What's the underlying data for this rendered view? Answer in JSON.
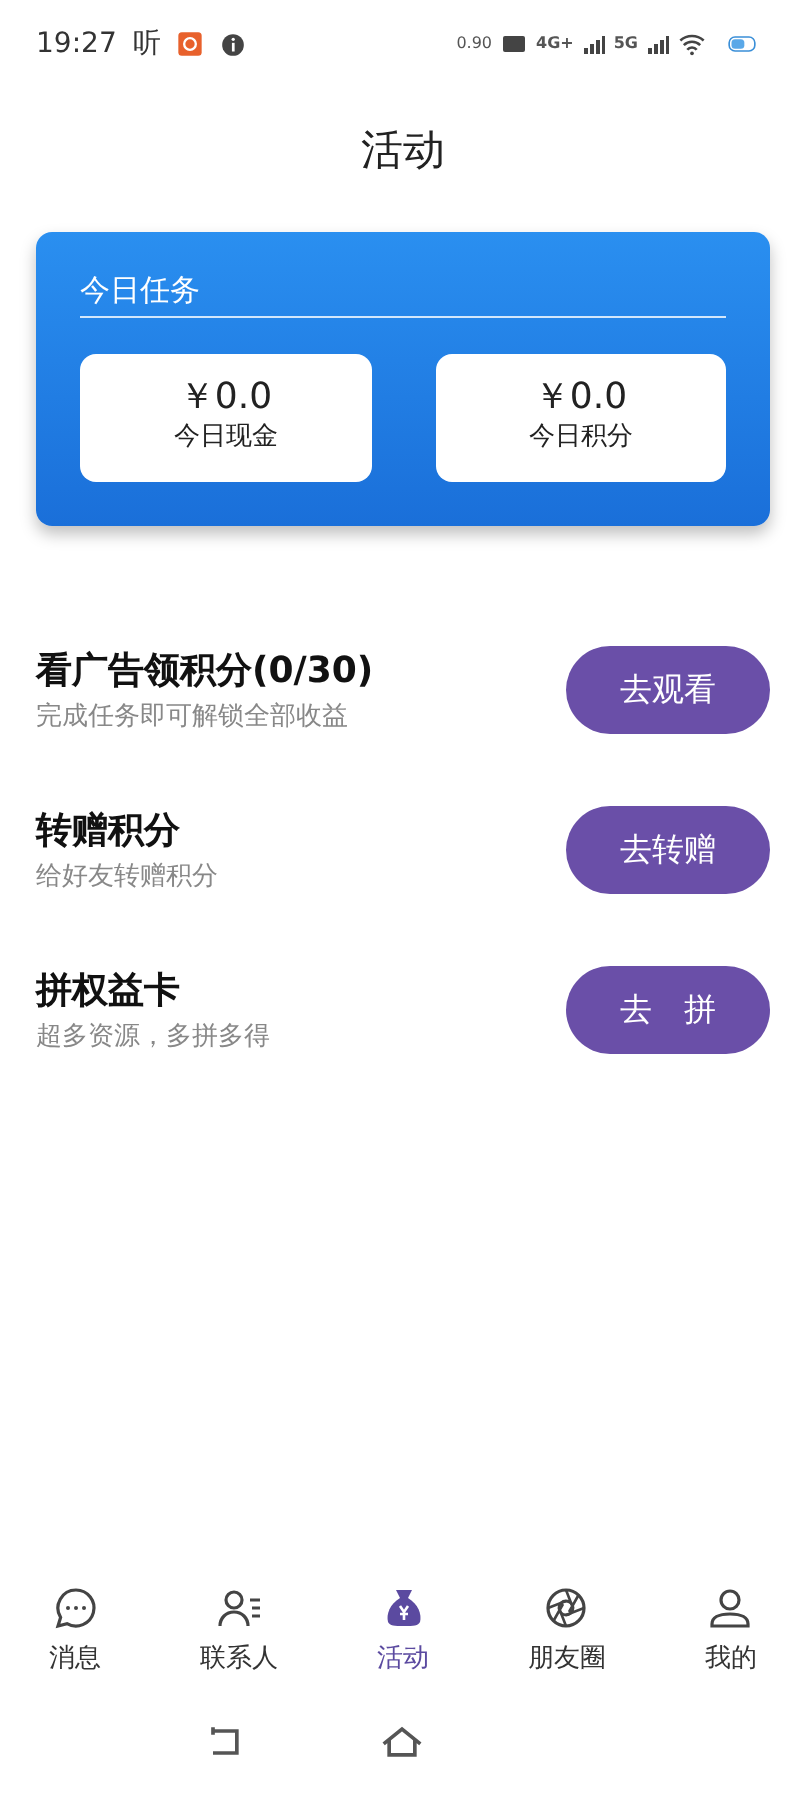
{
  "status_bar": {
    "time": "19:27",
    "app_glyph": "听",
    "net_speed": "0.90",
    "net_types": [
      "4G+",
      "5G"
    ]
  },
  "title": "活动",
  "today_card": {
    "heading": "今日任务",
    "stats": [
      {
        "value": "￥0.0",
        "label": "今日现金"
      },
      {
        "value": "￥0.0",
        "label": "今日积分"
      }
    ]
  },
  "tasks": [
    {
      "title": "看广告领积分(0/30)",
      "subtitle": "完成任务即可解锁全部收益",
      "button": "去观看"
    },
    {
      "title": "转赠积分",
      "subtitle": "给好友转赠积分",
      "button": "去转赠"
    },
    {
      "title": "拼权益卡",
      "subtitle": "超多资源，多拼多得",
      "button": "去　拼"
    }
  ],
  "tab_bar": [
    {
      "label": "消息",
      "kind": "chat",
      "selected": false
    },
    {
      "label": "联系人",
      "kind": "contacts",
      "selected": false
    },
    {
      "label": "活动",
      "kind": "moneybag",
      "selected": true
    },
    {
      "label": "朋友圈",
      "kind": "aperture",
      "selected": false
    },
    {
      "label": "我的",
      "kind": "person",
      "selected": false
    }
  ]
}
